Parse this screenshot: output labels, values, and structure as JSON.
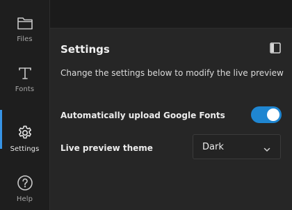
{
  "sidebar": {
    "items": [
      {
        "label": "Files",
        "icon": "folder-icon"
      },
      {
        "label": "Fonts",
        "icon": "font-icon"
      },
      {
        "label": "Settings",
        "icon": "gear-icon",
        "active": true
      },
      {
        "label": "Help",
        "icon": "help-icon"
      }
    ]
  },
  "settings": {
    "title": "Settings",
    "description": "Change the settings below to modify the live preview",
    "auto_upload_label": "Automatically upload Google Fonts",
    "auto_upload_enabled": true,
    "theme_label": "Live preview theme",
    "theme_value": "Dark"
  },
  "colors": {
    "accent": "#1f86d1",
    "active_indicator": "#3794e6",
    "background": "#262626"
  }
}
